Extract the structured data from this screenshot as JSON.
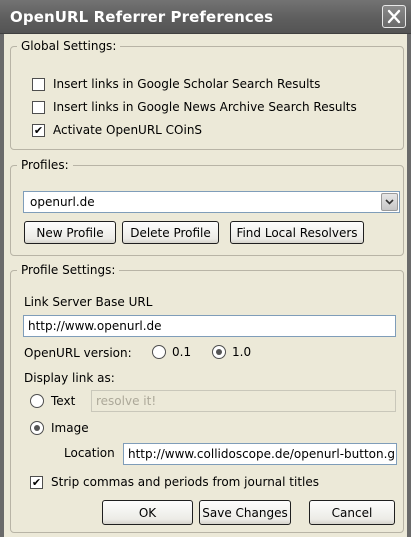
{
  "window": {
    "title": "OpenURL Referrer Preferences"
  },
  "global": {
    "legend": "Global Settings:",
    "options": [
      {
        "label": "Insert links in Google Scholar Search Results",
        "checked": false
      },
      {
        "label": "Insert links in Google News Archive Search Results",
        "checked": false
      },
      {
        "label": "Activate OpenURL COinS",
        "checked": true
      }
    ]
  },
  "profiles": {
    "legend": "Profiles:",
    "selected": "openurl.de",
    "buttons": {
      "new": "New Profile",
      "delete": "Delete Profile",
      "find": "Find Local Resolvers"
    }
  },
  "profile_settings": {
    "legend": "Profile Settings:",
    "base_url_label": "Link Server Base URL",
    "base_url_value": "http://www.openurl.de",
    "version_label": "OpenURL version:",
    "version_options": [
      "0.1",
      "1.0"
    ],
    "version_selected": "1.0",
    "display_label": "Display link as:",
    "text_option": "Text",
    "text_placeholder": "resolve it!",
    "image_option": "Image",
    "display_selected": "Image",
    "location_label": "Location",
    "location_value": "http://www.collidoscope.de/openurl-button.gif",
    "strip_label": "Strip commas and periods from journal titles",
    "strip_checked": true
  },
  "footer": {
    "ok": "OK",
    "save": "Save Changes",
    "cancel": "Cancel"
  },
  "colors": {
    "titlebar": "#5e5e5e",
    "dialog_bg": "#ece9d8",
    "input_border": "#7f9db9"
  }
}
